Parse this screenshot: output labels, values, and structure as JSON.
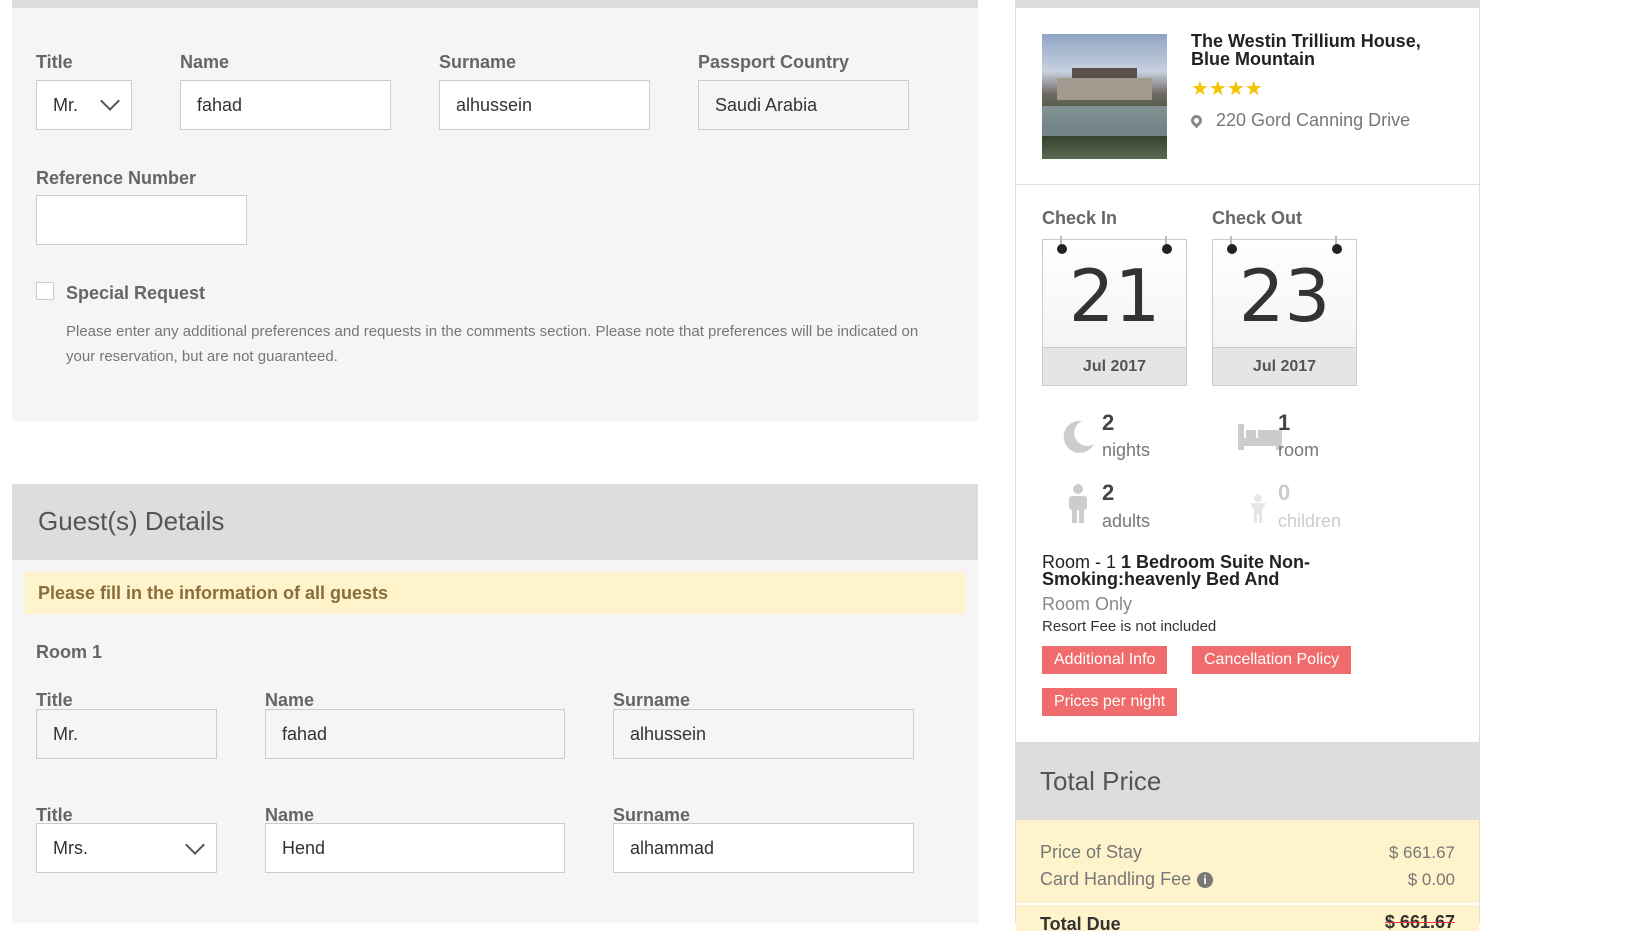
{
  "booker": {
    "title_label": "Title",
    "title_value": "Mr.",
    "name_label": "Name",
    "name_value": "fahad",
    "surname_label": "Surname",
    "surname_value": "alhussein",
    "passport_label": "Passport Country",
    "passport_value": "Saudi Arabia",
    "reference_label": "Reference Number",
    "reference_value": "",
    "special_request_label": "Special Request",
    "special_request_help": "Please enter any additional preferences and requests in the comments section. Please note that preferences will be indicated on your reservation, but are not guaranteed.",
    "special_request_checked": false
  },
  "guests": {
    "header": "Guest(s) Details",
    "notice": "Please fill in the information of all guests",
    "room_label": "Room 1",
    "rows": [
      {
        "title_label": "Title",
        "title_value": "Mr.",
        "name_label": "Name",
        "name_value": "fahad",
        "surname_label": "Surname",
        "surname_value": "alhussein"
      },
      {
        "title_label": "Title",
        "title_value": "Mrs.",
        "name_label": "Name",
        "name_value": "Hend",
        "surname_label": "Surname",
        "surname_value": "alhammad"
      }
    ]
  },
  "hotel": {
    "name": "The Westin Trillium House, Blue Mountain",
    "stars": "★★★★",
    "star_count": 4,
    "address": "220 Gord Canning Drive"
  },
  "stay": {
    "checkin_label": "Check In",
    "checkin_day": "21",
    "checkin_month": "Jul 2017",
    "checkout_label": "Check Out",
    "checkout_day": "23",
    "checkout_month": "Jul 2017",
    "nights_num": "2",
    "nights_txt": "nights",
    "rooms_num": "1",
    "rooms_txt": "room",
    "adults_num": "2",
    "adults_txt": "adults",
    "children_num": "0",
    "children_txt": "children"
  },
  "room": {
    "prefix": "Room - 1 ",
    "name": "1 Bedroom Suite Non-Smoking:heavenly Bed And",
    "board": "Room Only",
    "resort_fee": "Resort Fee is not included",
    "btn_info": "Additional Info",
    "btn_cancel": "Cancellation Policy",
    "btn_prices": "Prices per night"
  },
  "price": {
    "header": "Total Price",
    "stay_label": "Price of Stay",
    "stay_value": "$ 661.67",
    "fee_label": "Card Handling Fee",
    "fee_value": "$ 0.00",
    "total_label": "Total Due",
    "total_value": "$ 661.67"
  },
  "colors": {
    "accent_button": "#f06b6b",
    "notice_bg": "#fff3cc",
    "star": "#f5c400"
  }
}
